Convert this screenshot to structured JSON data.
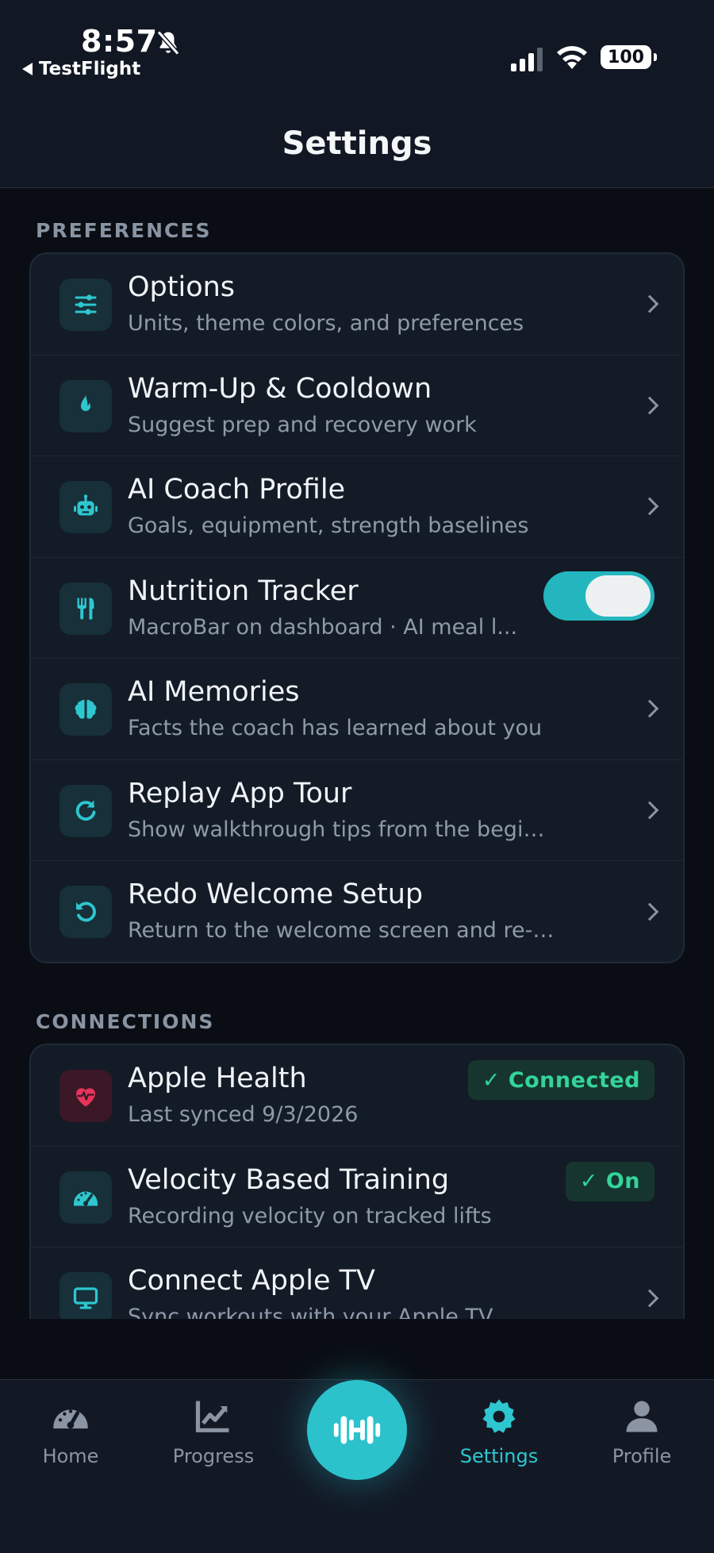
{
  "status_bar": {
    "time": "8:57",
    "back_label": "TestFlight",
    "battery": "100"
  },
  "header": {
    "title": "Settings"
  },
  "sections": [
    {
      "label": "PREFERENCES",
      "rows": [
        {
          "title": "Options",
          "subtitle": "Units, theme colors, and preferences",
          "icon": "sliders-icon",
          "control": "chevron"
        },
        {
          "title": "Warm-Up & Cooldown",
          "subtitle": "Suggest prep and recovery work",
          "icon": "flame-icon",
          "control": "chevron"
        },
        {
          "title": "AI Coach Profile",
          "subtitle": "Goals, equipment, strength baselines",
          "icon": "robot-icon",
          "control": "chevron"
        },
        {
          "title": "Nutrition Tracker",
          "subtitle": "MacroBar on dashboard · AI meal l...",
          "icon": "utensils-icon",
          "control": "toggle",
          "enabled": true
        },
        {
          "title": "AI Memories",
          "subtitle": "Facts the coach has learned about you",
          "icon": "brain-icon",
          "control": "chevron"
        },
        {
          "title": "Replay App Tour",
          "subtitle": "Show walkthrough tips from the beginning",
          "icon": "redo-icon",
          "control": "chevron"
        },
        {
          "title": "Redo Welcome Setup",
          "subtitle": "Return to the welcome screen and re-run t...",
          "icon": "undo-icon",
          "control": "chevron"
        }
      ]
    },
    {
      "label": "CONNECTIONS",
      "rows": [
        {
          "title": "Apple Health",
          "subtitle": "Last synced 9/3/2026",
          "icon": "heart-pulse-icon",
          "control": "badge",
          "badge": "✓ Connected"
        },
        {
          "title": "Velocity Based Training",
          "subtitle": "Recording velocity on tracked lifts",
          "icon": "gauge-icon",
          "control": "badge",
          "badge": "✓ On"
        },
        {
          "title": "Connect Apple TV",
          "subtitle": "Sync workouts with your Apple TV",
          "icon": "tv-icon",
          "control": "chevron"
        }
      ]
    }
  ],
  "tabbar": {
    "tabs": [
      {
        "label": "Home",
        "icon": "gauge-icon"
      },
      {
        "label": "Progress",
        "icon": "chart-line-icon"
      },
      {
        "label": "Settings",
        "icon": "gear-icon",
        "active": true
      },
      {
        "label": "Profile",
        "icon": "user-icon"
      }
    ],
    "center_icon": "dumbbell-icon"
  },
  "colors": {
    "accent": "#2cc2cb",
    "background": "#0a0e14",
    "card": "#131b26",
    "success": "#34d49b",
    "health": "#e8335a"
  }
}
